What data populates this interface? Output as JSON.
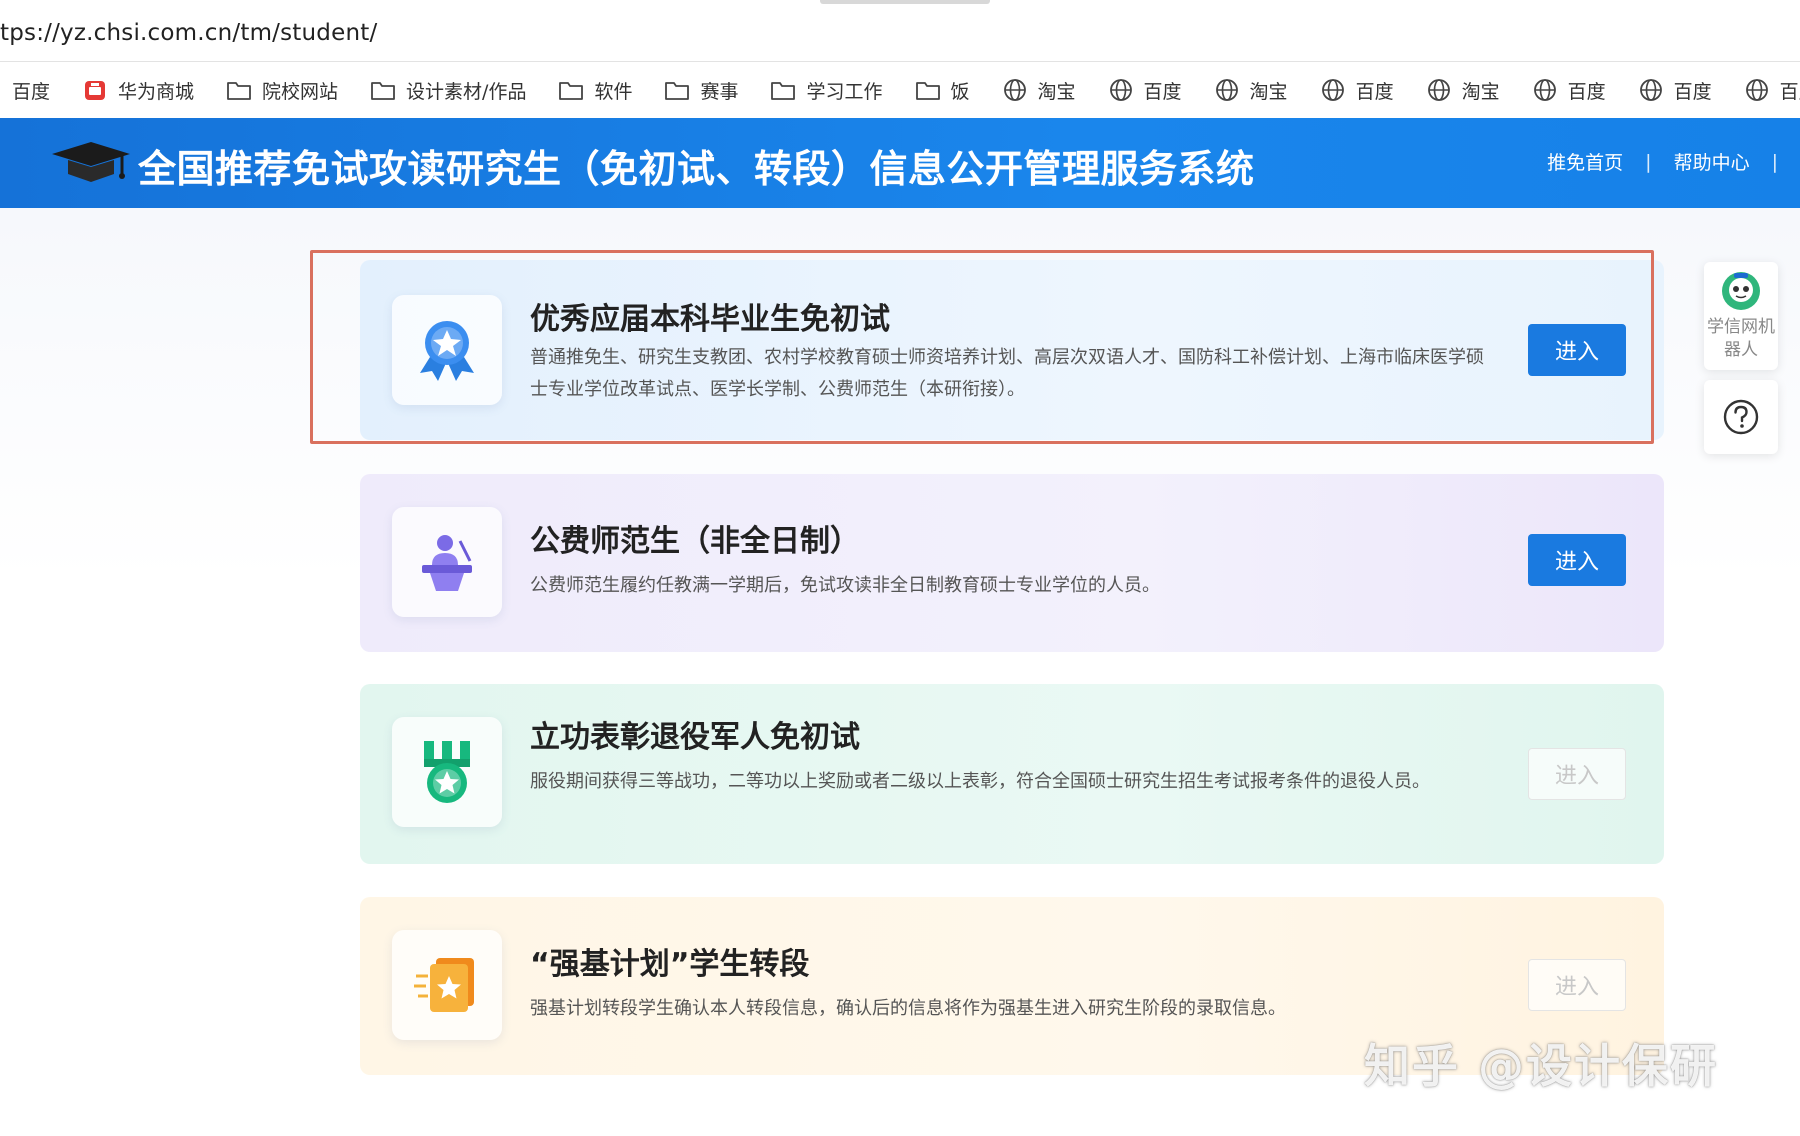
{
  "browser": {
    "url": "tps://yz.chsi.com.cn/tm/student/",
    "bookmarks": [
      {
        "label": "百度",
        "icon": "none"
      },
      {
        "label": "华为商城",
        "icon": "huawei-store-icon"
      },
      {
        "label": "院校网站",
        "icon": "folder-icon"
      },
      {
        "label": "设计素材/作品",
        "icon": "folder-icon"
      },
      {
        "label": "软件",
        "icon": "folder-icon"
      },
      {
        "label": "赛事",
        "icon": "folder-icon"
      },
      {
        "label": "学习工作",
        "icon": "folder-icon"
      },
      {
        "label": "饭",
        "icon": "folder-icon"
      },
      {
        "label": "淘宝",
        "icon": "globe-icon"
      },
      {
        "label": "百度",
        "icon": "globe-icon"
      },
      {
        "label": "淘宝",
        "icon": "globe-icon"
      },
      {
        "label": "百度",
        "icon": "globe-icon"
      },
      {
        "label": "淘宝",
        "icon": "globe-icon"
      },
      {
        "label": "百度",
        "icon": "globe-icon"
      },
      {
        "label": "百度",
        "icon": "globe-icon"
      },
      {
        "label": "百度",
        "icon": "globe-icon"
      },
      {
        "label": "",
        "icon": "globe-icon"
      }
    ]
  },
  "header": {
    "title": "全国推荐免试攻读研究生（免初试、转段）信息公开管理服务系统",
    "nav": [
      "推免首页",
      "帮助中心"
    ],
    "separator": "|"
  },
  "cards": [
    {
      "title": "优秀应届本科毕业生免初试",
      "description": "普通推免生、研究生支教团、农村学校教育硕士师资培养计划、高层次双语人才、国防科工补偿计划、上海市临床医学硕士专业学位改革试点、医学长学制、公费师范生（本研衔接）。",
      "button": "进入",
      "enabled": true,
      "icon": "award-ribbon-icon",
      "highlighted": true
    },
    {
      "title": "公费师范生（非全日制）",
      "description": "公费师范生履约任教满一学期后，免试攻读非全日制教育硕士专业学位的人员。",
      "button": "进入",
      "enabled": true,
      "icon": "teacher-podium-icon",
      "highlighted": false
    },
    {
      "title": "立功表彰退役军人免初试",
      "description": "服役期间获得三等战功，二等功以上奖励或者二级以上表彰，符合全国硕士研究生招生考试报考条件的退役人员。",
      "button": "进入",
      "enabled": false,
      "icon": "military-medal-icon",
      "highlighted": false
    },
    {
      "title": "“强基计划”学生转段",
      "description": "强基计划转段学生确认本人转段信息，确认后的信息将作为强基生进入研究生阶段的录取信息。",
      "button": "进入",
      "enabled": false,
      "icon": "star-certificate-icon",
      "highlighted": false
    }
  ],
  "side_widgets": {
    "robot_label": "学信网机器人",
    "help_icon": "question-circle-icon"
  },
  "watermark": "知乎 @设计保研",
  "colors": {
    "header_blue": "#1a7ae0",
    "highlight_border": "#d9705e",
    "button_active": "#1a7ae0"
  }
}
